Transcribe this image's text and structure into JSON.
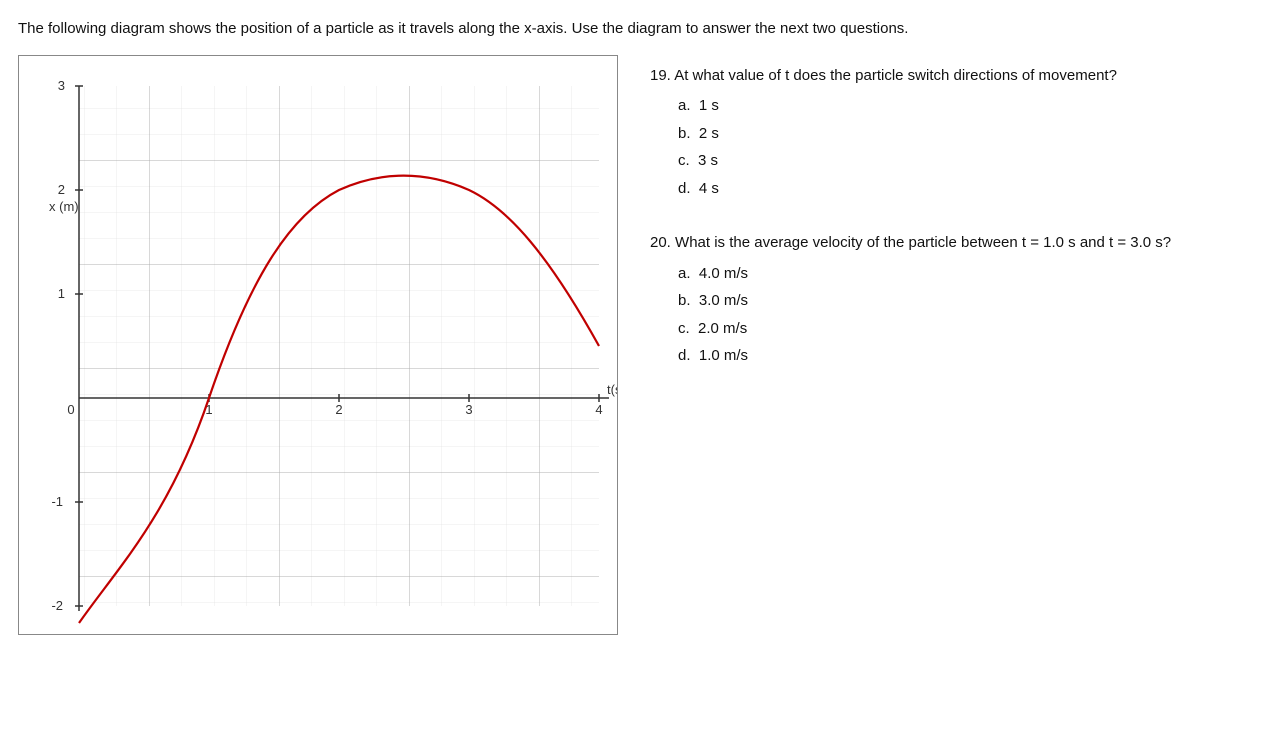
{
  "intro": {
    "text": "The following diagram shows the position of a particle as it travels along the x-axis.  Use the diagram to answer the next two questions."
  },
  "graph": {
    "x_axis_label": "t(s)",
    "y_axis_label": "x (m)",
    "x_min": 0,
    "x_max": 4,
    "y_min": -2,
    "y_max": 3,
    "grid_color": "#c8c8c8",
    "curve_color": "#c00000",
    "axis_color": "#333"
  },
  "questions": [
    {
      "number": "19.",
      "text": "At what value of t does the particle switch directions of movement?",
      "options": [
        {
          "label": "a.",
          "value": "1 s"
        },
        {
          "label": "b.",
          "value": "2 s"
        },
        {
          "label": "c.",
          "value": "3 s"
        },
        {
          "label": "d.",
          "value": "4 s"
        }
      ]
    },
    {
      "number": "20.",
      "text": "What is the average velocity of the particle between t = 1.0 s and t = 3.0 s?",
      "options": [
        {
          "label": "a.",
          "value": "4.0 m/s"
        },
        {
          "label": "b.",
          "value": "3.0 m/s"
        },
        {
          "label": "c.",
          "value": "2.0 m/s"
        },
        {
          "label": "d.",
          "value": "1.0 m/s"
        }
      ]
    }
  ]
}
